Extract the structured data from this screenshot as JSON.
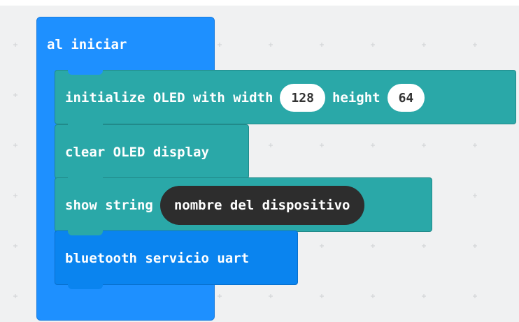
{
  "on_start": {
    "label": "al iniciar"
  },
  "blocks": {
    "init_oled": {
      "text": "initialize OLED with width",
      "width_value": "128",
      "height_label": "height",
      "height_value": "64"
    },
    "clear_oled": {
      "text": "clear OLED display"
    },
    "show_string": {
      "text": "show string",
      "value": "nombre del dispositivo"
    },
    "bluetooth": {
      "text": "bluetooth servicio uart"
    }
  },
  "colors": {
    "workspace": "#f0f1f2",
    "on_start": "#1e90ff",
    "oled_category": "#2aa8a8",
    "bluetooth_category": "#0a84ef",
    "string_value": "#2d2d2d",
    "grid_dot": "#d4d6d8"
  }
}
